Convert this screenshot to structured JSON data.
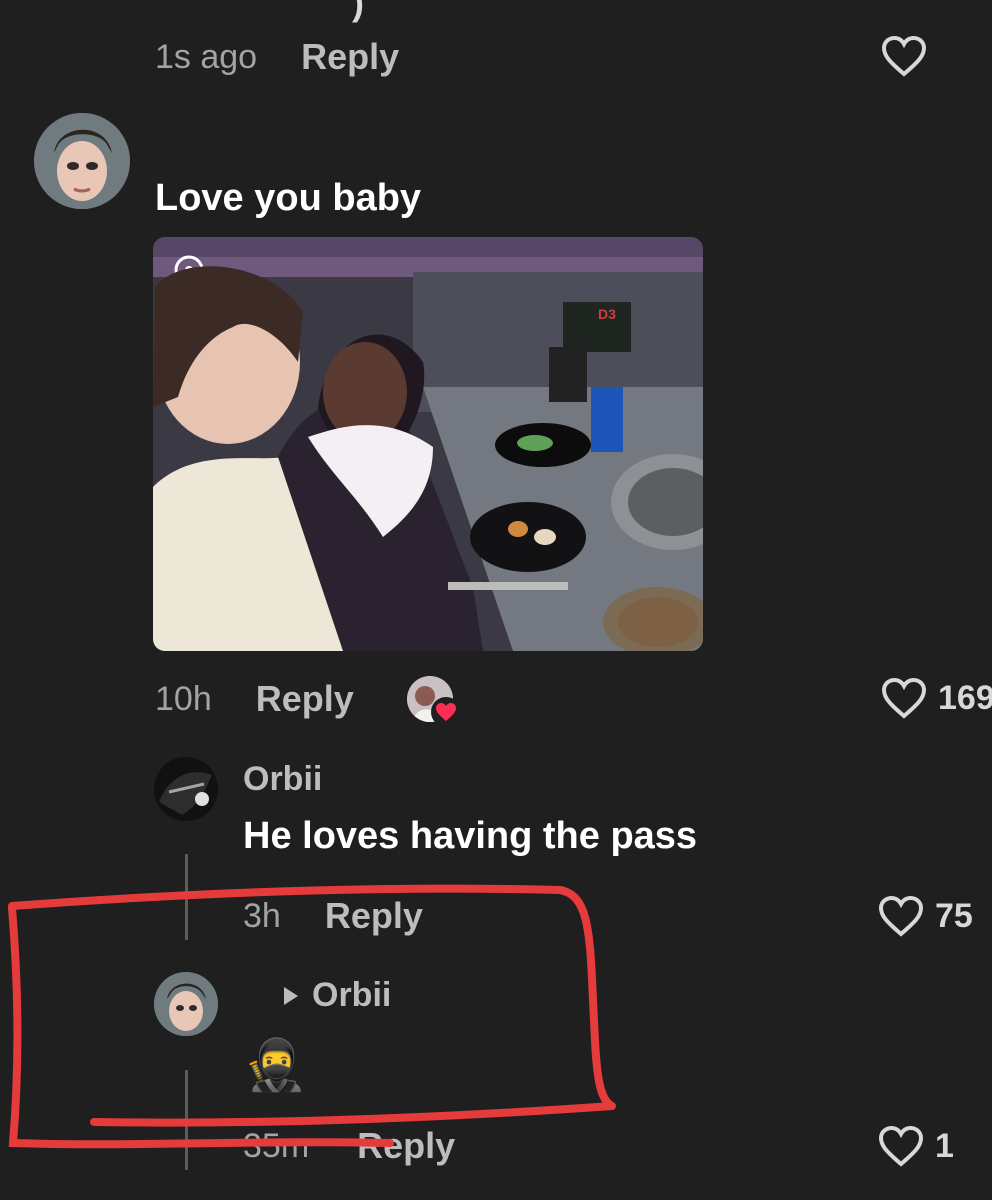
{
  "top_comment": {
    "time": "1s ago",
    "reply_label": "Reply"
  },
  "main_comment": {
    "text": "Love you baby",
    "time": "10h",
    "reply_label": "Reply",
    "likes": "169"
  },
  "reply_1": {
    "username": "Orbii",
    "text": "He loves having the pass",
    "time": "3h",
    "reply_label": "Reply",
    "likes": "75"
  },
  "reply_2": {
    "reply_to": "Orbii",
    "emoji": "🥷",
    "time": "35m",
    "reply_label": "Reply",
    "likes": "1"
  },
  "photo_sign_label": "D3",
  "colors": {
    "background": "#1f1f20",
    "annotation": "#e53b3b",
    "liked_heart": "#ff2d55"
  },
  "icons": [
    "heart-outline-icon",
    "triangle-right-icon",
    "heart-badge-icon"
  ]
}
